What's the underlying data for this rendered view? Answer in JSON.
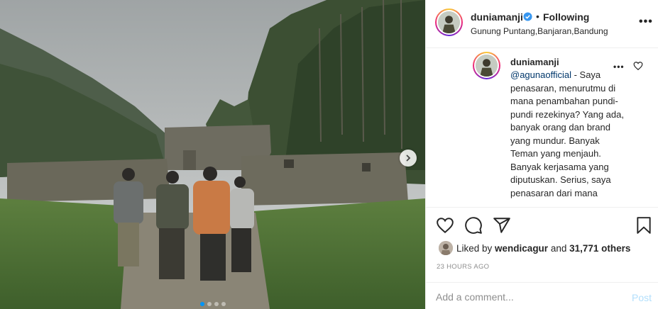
{
  "post": {
    "username": "duniamanji",
    "verified": true,
    "separator": "•",
    "follow_status": "Following",
    "location": "Gunung Puntang,Banjaran,Bandung"
  },
  "caption": {
    "username": "duniamanji",
    "mention": "@agunaofficial",
    "text": " - Saya penasaran, menurutmu di mana penambahan pundi-pundi rezekinya? Yang ada, banyak orang dan brand yang mundur. Banyak Teman yang menjauh. Banyak kerjasama yang diputuskan. Serius, saya penasaran dari mana"
  },
  "likes": {
    "prefix": "Liked by ",
    "liker": "wendicagur",
    "middle": " and ",
    "count": "31,771 others"
  },
  "timestamp": "23 HOURS AGO",
  "comment": {
    "placeholder": "Add a comment...",
    "post_label": "Post"
  },
  "carousel": {
    "total": 4,
    "active_index": 0
  },
  "colors": {
    "verified": "#3897f0",
    "link": "#00376b",
    "post_disabled": "#b2dffc",
    "active_dot": "#0095f6"
  },
  "icons": [
    "verified-badge-icon",
    "more-options-icon",
    "heart-icon",
    "comment-icon",
    "share-icon",
    "bookmark-icon",
    "chevron-right-icon"
  ]
}
